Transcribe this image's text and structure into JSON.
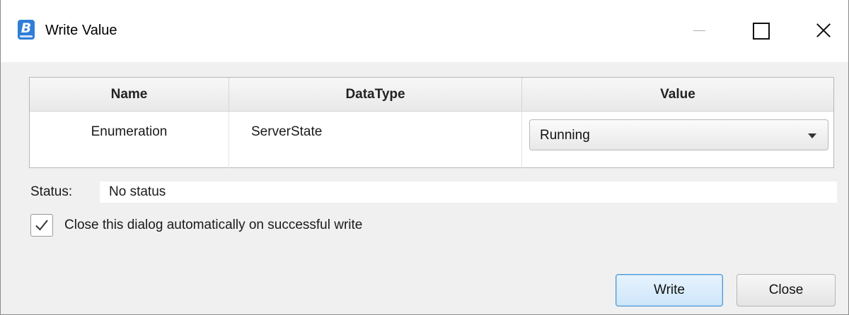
{
  "window": {
    "title": "Write Value",
    "app_icon_letter": "B",
    "controls": {
      "minimize_icon": "minimize-icon",
      "maximize_icon": "maximize-icon",
      "close_icon": "close-icon"
    }
  },
  "table": {
    "headers": {
      "name": "Name",
      "datatype": "DataType",
      "value": "Value"
    },
    "rows": [
      {
        "name": "Enumeration",
        "datatype": "ServerState",
        "value": "Running"
      }
    ]
  },
  "status": {
    "label": "Status:",
    "value": "No status"
  },
  "auto_close": {
    "label": "Close this dialog automatically on successful write",
    "checked": true
  },
  "buttons": {
    "write": "Write",
    "close": "Close"
  },
  "colors": {
    "accent_border": "#4d97d6",
    "app_icon": "#2f7ed8",
    "dialog_bg": "#f0f0f0"
  }
}
